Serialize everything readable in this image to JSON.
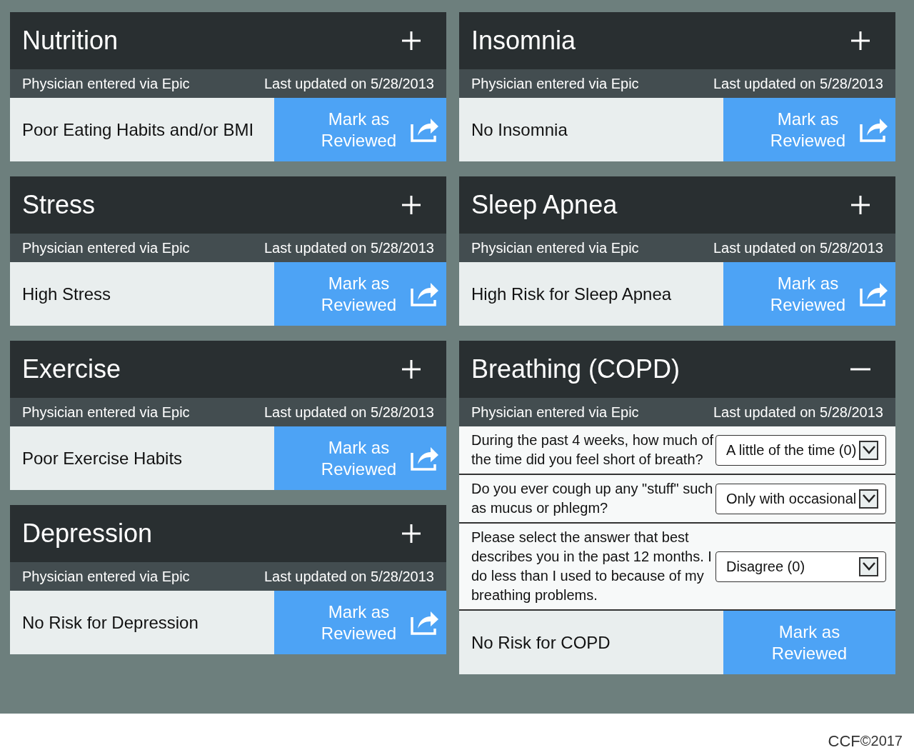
{
  "columns": [
    {
      "cards": [
        {
          "title": "Nutrition",
          "expanded": false,
          "source": "Physician entered via Epic",
          "updated": "Last updated on 5/28/2013",
          "result": "Poor Eating Habits and/or BMI",
          "button": {
            "label": "Mark as Reviewed",
            "show_icon": true
          }
        },
        {
          "title": "Stress",
          "expanded": false,
          "source": "Physician entered via Epic",
          "updated": "Last updated on 5/28/2013",
          "result": "High Stress",
          "button": {
            "label": "Mark as Reviewed",
            "show_icon": true
          }
        },
        {
          "title": "Exercise",
          "expanded": false,
          "source": "Physician entered via Epic",
          "updated": "Last updated on 5/28/2013",
          "result": "Poor Exercise Habits",
          "button": {
            "label": "Mark as Reviewed",
            "show_icon": true
          }
        },
        {
          "title": "Depression",
          "expanded": false,
          "source": "Physician entered via Epic",
          "updated": "Last updated on 5/28/2013",
          "result": "No Risk for Depression",
          "button": {
            "label": "Mark as Reviewed",
            "show_icon": true
          }
        }
      ]
    },
    {
      "cards": [
        {
          "title": "Insomnia",
          "expanded": false,
          "source": "Physician entered via Epic",
          "updated": "Last updated on 5/28/2013",
          "result": "No Insomnia",
          "button": {
            "label": "Mark as Reviewed",
            "show_icon": true
          }
        },
        {
          "title": "Sleep Apnea",
          "expanded": false,
          "source": "Physician entered via Epic",
          "updated": "Last updated on 5/28/2013",
          "result": "High Risk for Sleep Apnea",
          "button": {
            "label": "Mark as Reviewed",
            "show_icon": true
          }
        },
        {
          "title": "Breathing (COPD)",
          "expanded": true,
          "source": "Physician entered via Epic",
          "updated": "Last updated on 5/28/2013",
          "questions": [
            {
              "question": "During the past 4 weeks, how much of the time did you feel short of breath?",
              "answer": "A little of the time (0)"
            },
            {
              "question": "Do you ever cough up any \"stuff\" such as mucus or phlegm?",
              "answer": "Only with occasional"
            },
            {
              "question": "Please select the answer that best describes you in the past 12 months. I do less than I used to because of my breathing problems.",
              "answer": "Disagree (0)"
            }
          ],
          "result": "No Risk for COPD",
          "button": {
            "label": "Mark as Reviewed",
            "show_icon": false
          }
        }
      ]
    }
  ],
  "footer": {
    "credit": "CCF",
    "year": "©2017"
  }
}
